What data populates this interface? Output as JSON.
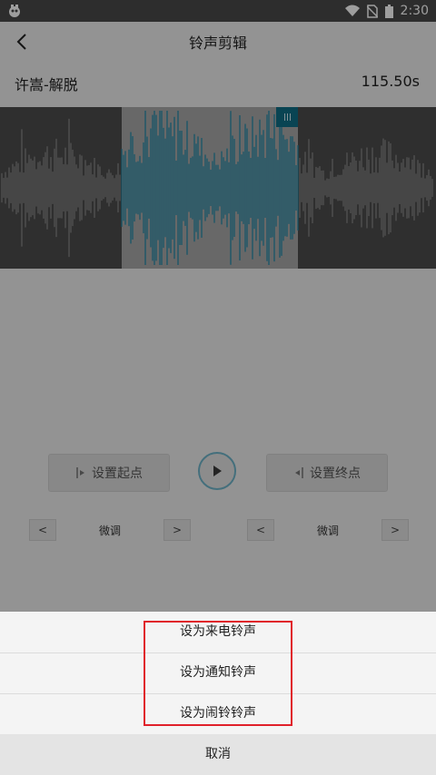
{
  "status_bar": {
    "time": "2:30"
  },
  "header": {
    "title": "铃声剪辑"
  },
  "song": {
    "name": "许嵩-解脱",
    "duration": "115.50s"
  },
  "controls": {
    "set_start": "设置起点",
    "set_end": "设置终点",
    "fine_tune_left": "微调",
    "fine_tune_right": "微调"
  },
  "action_sheet": {
    "options": [
      "设为来电铃声",
      "设为通知铃声",
      "设为闹铃铃声"
    ],
    "cancel": "取消"
  },
  "colors": {
    "accent": "#1a86a6",
    "highlight": "#e0202a"
  }
}
